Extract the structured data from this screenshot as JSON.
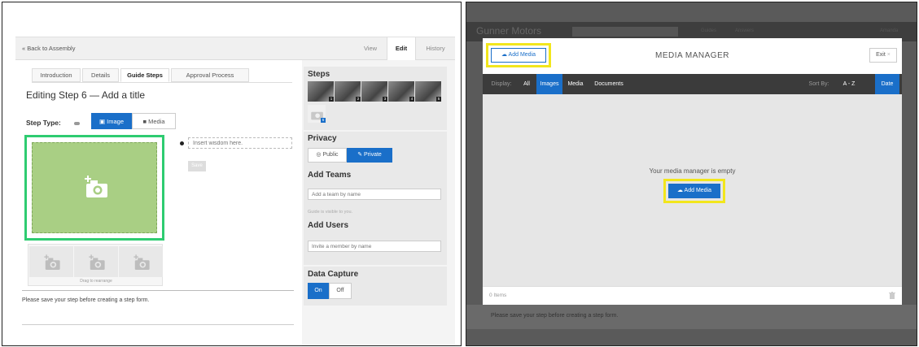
{
  "left": {
    "back_link": "« Back to Assembly",
    "mode_tabs": {
      "view": "View",
      "edit": "Edit",
      "history": "History"
    },
    "tabs": [
      "Introduction",
      "Details",
      "Guide Steps",
      "Approval Process"
    ],
    "step_title": "Editing Step 6 — Add a title",
    "step_type_label": "Step Type:",
    "image_btn": "Image",
    "media_btn": "Media",
    "wisdom_placeholder": "Insert wisdom here.",
    "save_btn": "Save",
    "drag_label": "Drag to rearrange",
    "save_note": "Please save your step before creating a step form.",
    "sidebar": {
      "steps_heading": "Steps",
      "step_numbers": [
        "1",
        "2",
        "3",
        "4",
        "5",
        "6"
      ],
      "privacy_heading": "Privacy",
      "public_btn": "Public",
      "private_btn": "Private",
      "add_teams_heading": "Add Teams",
      "team_placeholder": "Add a team by name",
      "visibility_note": "Guide is visible to you.",
      "add_users_heading": "Add Users",
      "user_placeholder": "Invite a member by name",
      "capture_heading": "Data Capture",
      "on_btn": "On",
      "off_btn": "Off"
    }
  },
  "right": {
    "brand": "Gunner Motors",
    "nav": [
      "Guides",
      "Answers"
    ],
    "nav_user": "Amanda",
    "add_media_top": "Add Media",
    "title": "MEDIA MANAGER",
    "exit_btn": "Exit",
    "display_label": "Display:",
    "filters": [
      "All",
      "Images",
      "Media",
      "Documents"
    ],
    "sort_label": "Sort By:",
    "sort_options": [
      "A - Z",
      "Date"
    ],
    "empty_text": "Your media manager is empty",
    "add_media_center": "Add Media",
    "items_count": "0 Items",
    "bottom_note": "Please save your step before creating a step form.",
    "colors": {
      "accent": "#1a6fc9",
      "highlight": "#f2e61c",
      "green": "#2ecc71"
    }
  }
}
